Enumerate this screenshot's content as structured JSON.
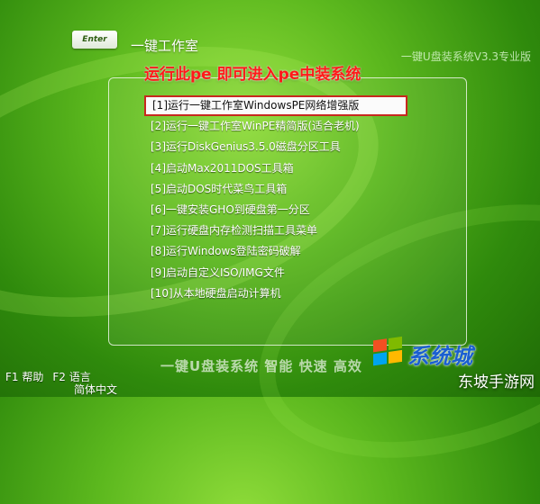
{
  "header": {
    "logo_text": "Enter",
    "brand": "一键工作室",
    "version": "一键U盘装系统V3.3专业版",
    "hint": "运行此pe 即可进入pe中装系统"
  },
  "menu": {
    "selected_index": 0,
    "items": [
      "[1]运行一键工作室WindowsPE网络增强版",
      "[2]运行一键工作室WinPE精简版(适合老机)",
      "[3]运行DiskGenius3.5.0磁盘分区工具",
      "[4]启动Max2011DOS工具箱",
      "[5]启动DOS时代菜鸟工具箱",
      "[6]一键安装GHO到硬盘第一分区",
      "[7]运行硬盘内存检测扫描工具菜单",
      "[8]运行Windows登陆密码破解",
      "[9]启动自定义ISO/IMG文件",
      "[10]从本地硬盘启动计算机"
    ]
  },
  "footer": {
    "f1": "F1 帮助",
    "f2": "F2 语言",
    "f2_sub": "简体中文",
    "banner": "一键U盘装系统 智能 快速 高效",
    "site_logo_text": "系统城",
    "watermark": "东坡手游网"
  }
}
